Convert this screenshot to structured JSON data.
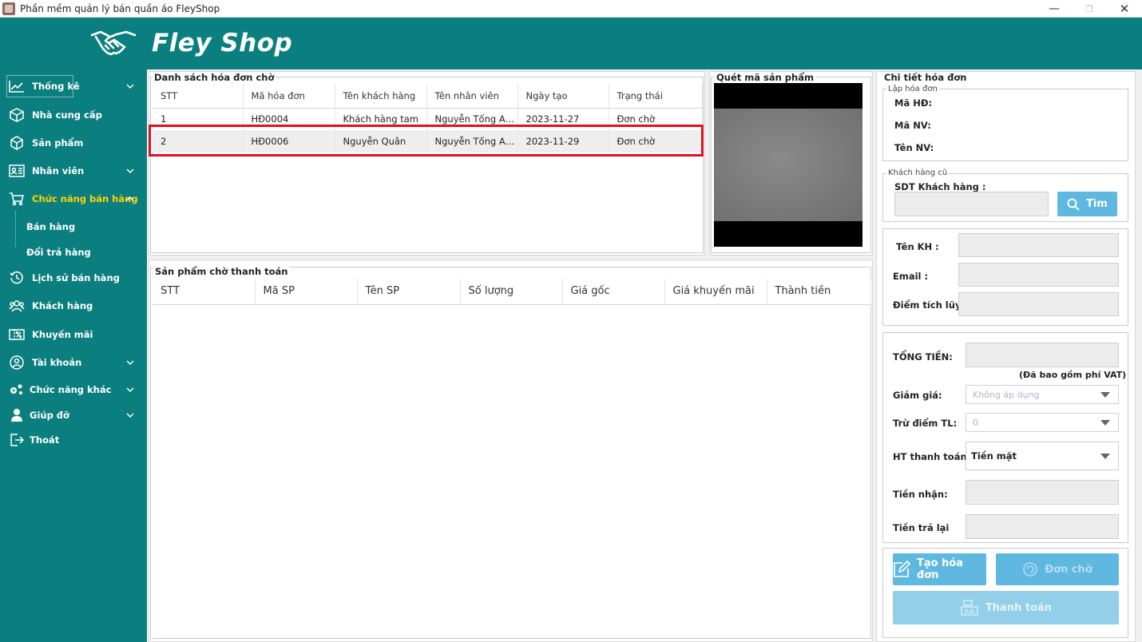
{
  "window": {
    "title": "Phần mềm quản lý bán quần áo FleyShop"
  },
  "header": {
    "brand": "Fley Shop"
  },
  "sidebar": {
    "items": [
      {
        "label": "Thống kê",
        "icon": "chart-line-icon",
        "has_chevron": true
      },
      {
        "label": "Nhà cung cấp",
        "icon": "box-icon",
        "has_chevron": false
      },
      {
        "label": "Sản phẩm",
        "icon": "cube-icon",
        "has_chevron": false
      },
      {
        "label": "Nhân viên",
        "icon": "id-card-icon",
        "has_chevron": true
      },
      {
        "label": "Chức năng bán hàng",
        "icon": "cart-icon",
        "has_chevron": true,
        "active": true
      },
      {
        "label": "Lịch sử bán hàng",
        "icon": "history-icon",
        "has_chevron": false
      },
      {
        "label": "Khách hàng",
        "icon": "users-icon",
        "has_chevron": false
      },
      {
        "label": "Khuyến mãi",
        "icon": "ticket-icon",
        "has_chevron": false
      },
      {
        "label": "Tài khoản",
        "icon": "user-circle-icon",
        "has_chevron": true
      },
      {
        "label": "Chức năng khác",
        "icon": "settings-icon",
        "has_chevron": true
      },
      {
        "label": "Giúp đỡ",
        "icon": "support-icon",
        "has_chevron": true
      },
      {
        "label": "Thoát",
        "icon": "logout-icon",
        "has_chevron": false
      }
    ],
    "subitems": [
      "Bán hàng",
      "Đổi trả hàng"
    ],
    "active_color": "#ffd400"
  },
  "pending_invoices": {
    "title": "Danh sách hóa đơn chờ",
    "columns": [
      "STT",
      "Mã hóa đơn",
      "Tên khách hàng",
      "Tên nhân viên",
      "Ngày tạo",
      "Trạng thái"
    ],
    "rows": [
      [
        "1",
        "HĐ0004",
        "Khách  hàng tam",
        "Nguyễn Tống Anh ...",
        "2023-11-27",
        "Đơn chờ"
      ],
      [
        "2",
        "HĐ0006",
        "Nguyễn Quân",
        "Nguyễn Tống Anh ...",
        "2023-11-29",
        "Đơn chờ"
      ]
    ],
    "highlight_color": "#e01020"
  },
  "scanner": {
    "title": "Quét mã sản phẩm"
  },
  "pending_products": {
    "title": "Sản phẩm chờ thanh toán",
    "columns": [
      "STT",
      "Mã SP",
      "Tên SP",
      "Số lượng",
      "Giá gốc",
      "Giá khuyến mãi",
      "Thành tiền"
    ]
  },
  "invoice_detail": {
    "title": "Chi tiết hóa đơn",
    "create_group": "Lập hóa đơn",
    "ma_hd_label": "Mã HĐ:",
    "ma_nv_label": "Mã NV:",
    "ten_nv_label": "Tên NV:",
    "old_customer_group": "Khách hàng cũ",
    "sdt_label": "SDT Khách hàng :",
    "search_button": "Tìm",
    "ten_kh_label": "Tên KH :",
    "email_label": "Email :",
    "diem_label": "Điểm tích lũy:",
    "tong_tien_label": "TỔNG TIỀN:",
    "vat_note": "(Đã bao gồm phí VAT)",
    "giam_gia_label": "Giảm giá:",
    "giam_gia_value": "Không áp dụng",
    "tru_diem_label": "Trừ điểm TL:",
    "tru_diem_value": "0",
    "ht_thanh_toan_label": "HT thanh toán :",
    "ht_thanh_toan_value": "Tiền mặt",
    "tien_nhan_label": "Tiền nhận:",
    "tien_tra_lai_label": "Tiền trả lại",
    "btn_create": "Tạo hóa đơn",
    "btn_pending": "Đơn chờ",
    "btn_pay": "Thanh toán"
  },
  "colors": {
    "teal": "#0b7f7f",
    "button_blue": "#5fb8e0",
    "button_disabled": "#93cfe9"
  }
}
